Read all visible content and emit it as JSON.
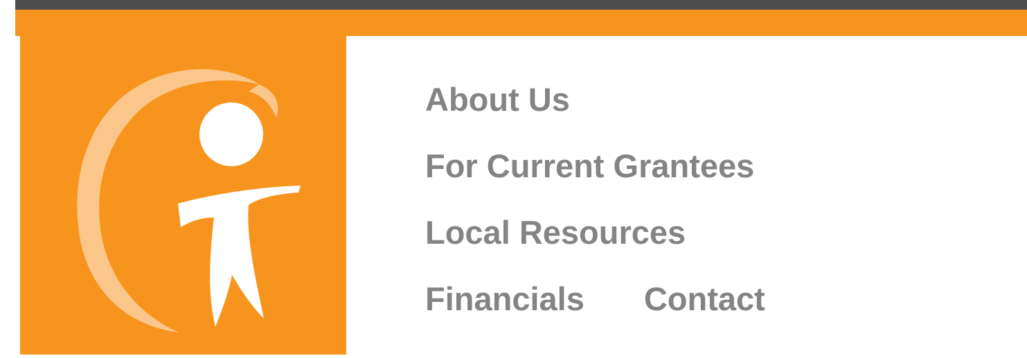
{
  "brand": {
    "logo_icon": "stylized-letter-g-person-icon",
    "colors": {
      "accent_orange": "#f7941d",
      "dark_bar": "#4d4d4d",
      "nav_text_gray": "#848484",
      "logo_light": "#fbc68a",
      "logo_white": "#ffffff"
    }
  },
  "nav": {
    "rows": [
      [
        {
          "label": "About Us"
        }
      ],
      [
        {
          "label": "For Current Grantees"
        }
      ],
      [
        {
          "label": "Local Resources"
        }
      ],
      [
        {
          "label": "Financials"
        },
        {
          "label": "Contact"
        }
      ]
    ]
  }
}
